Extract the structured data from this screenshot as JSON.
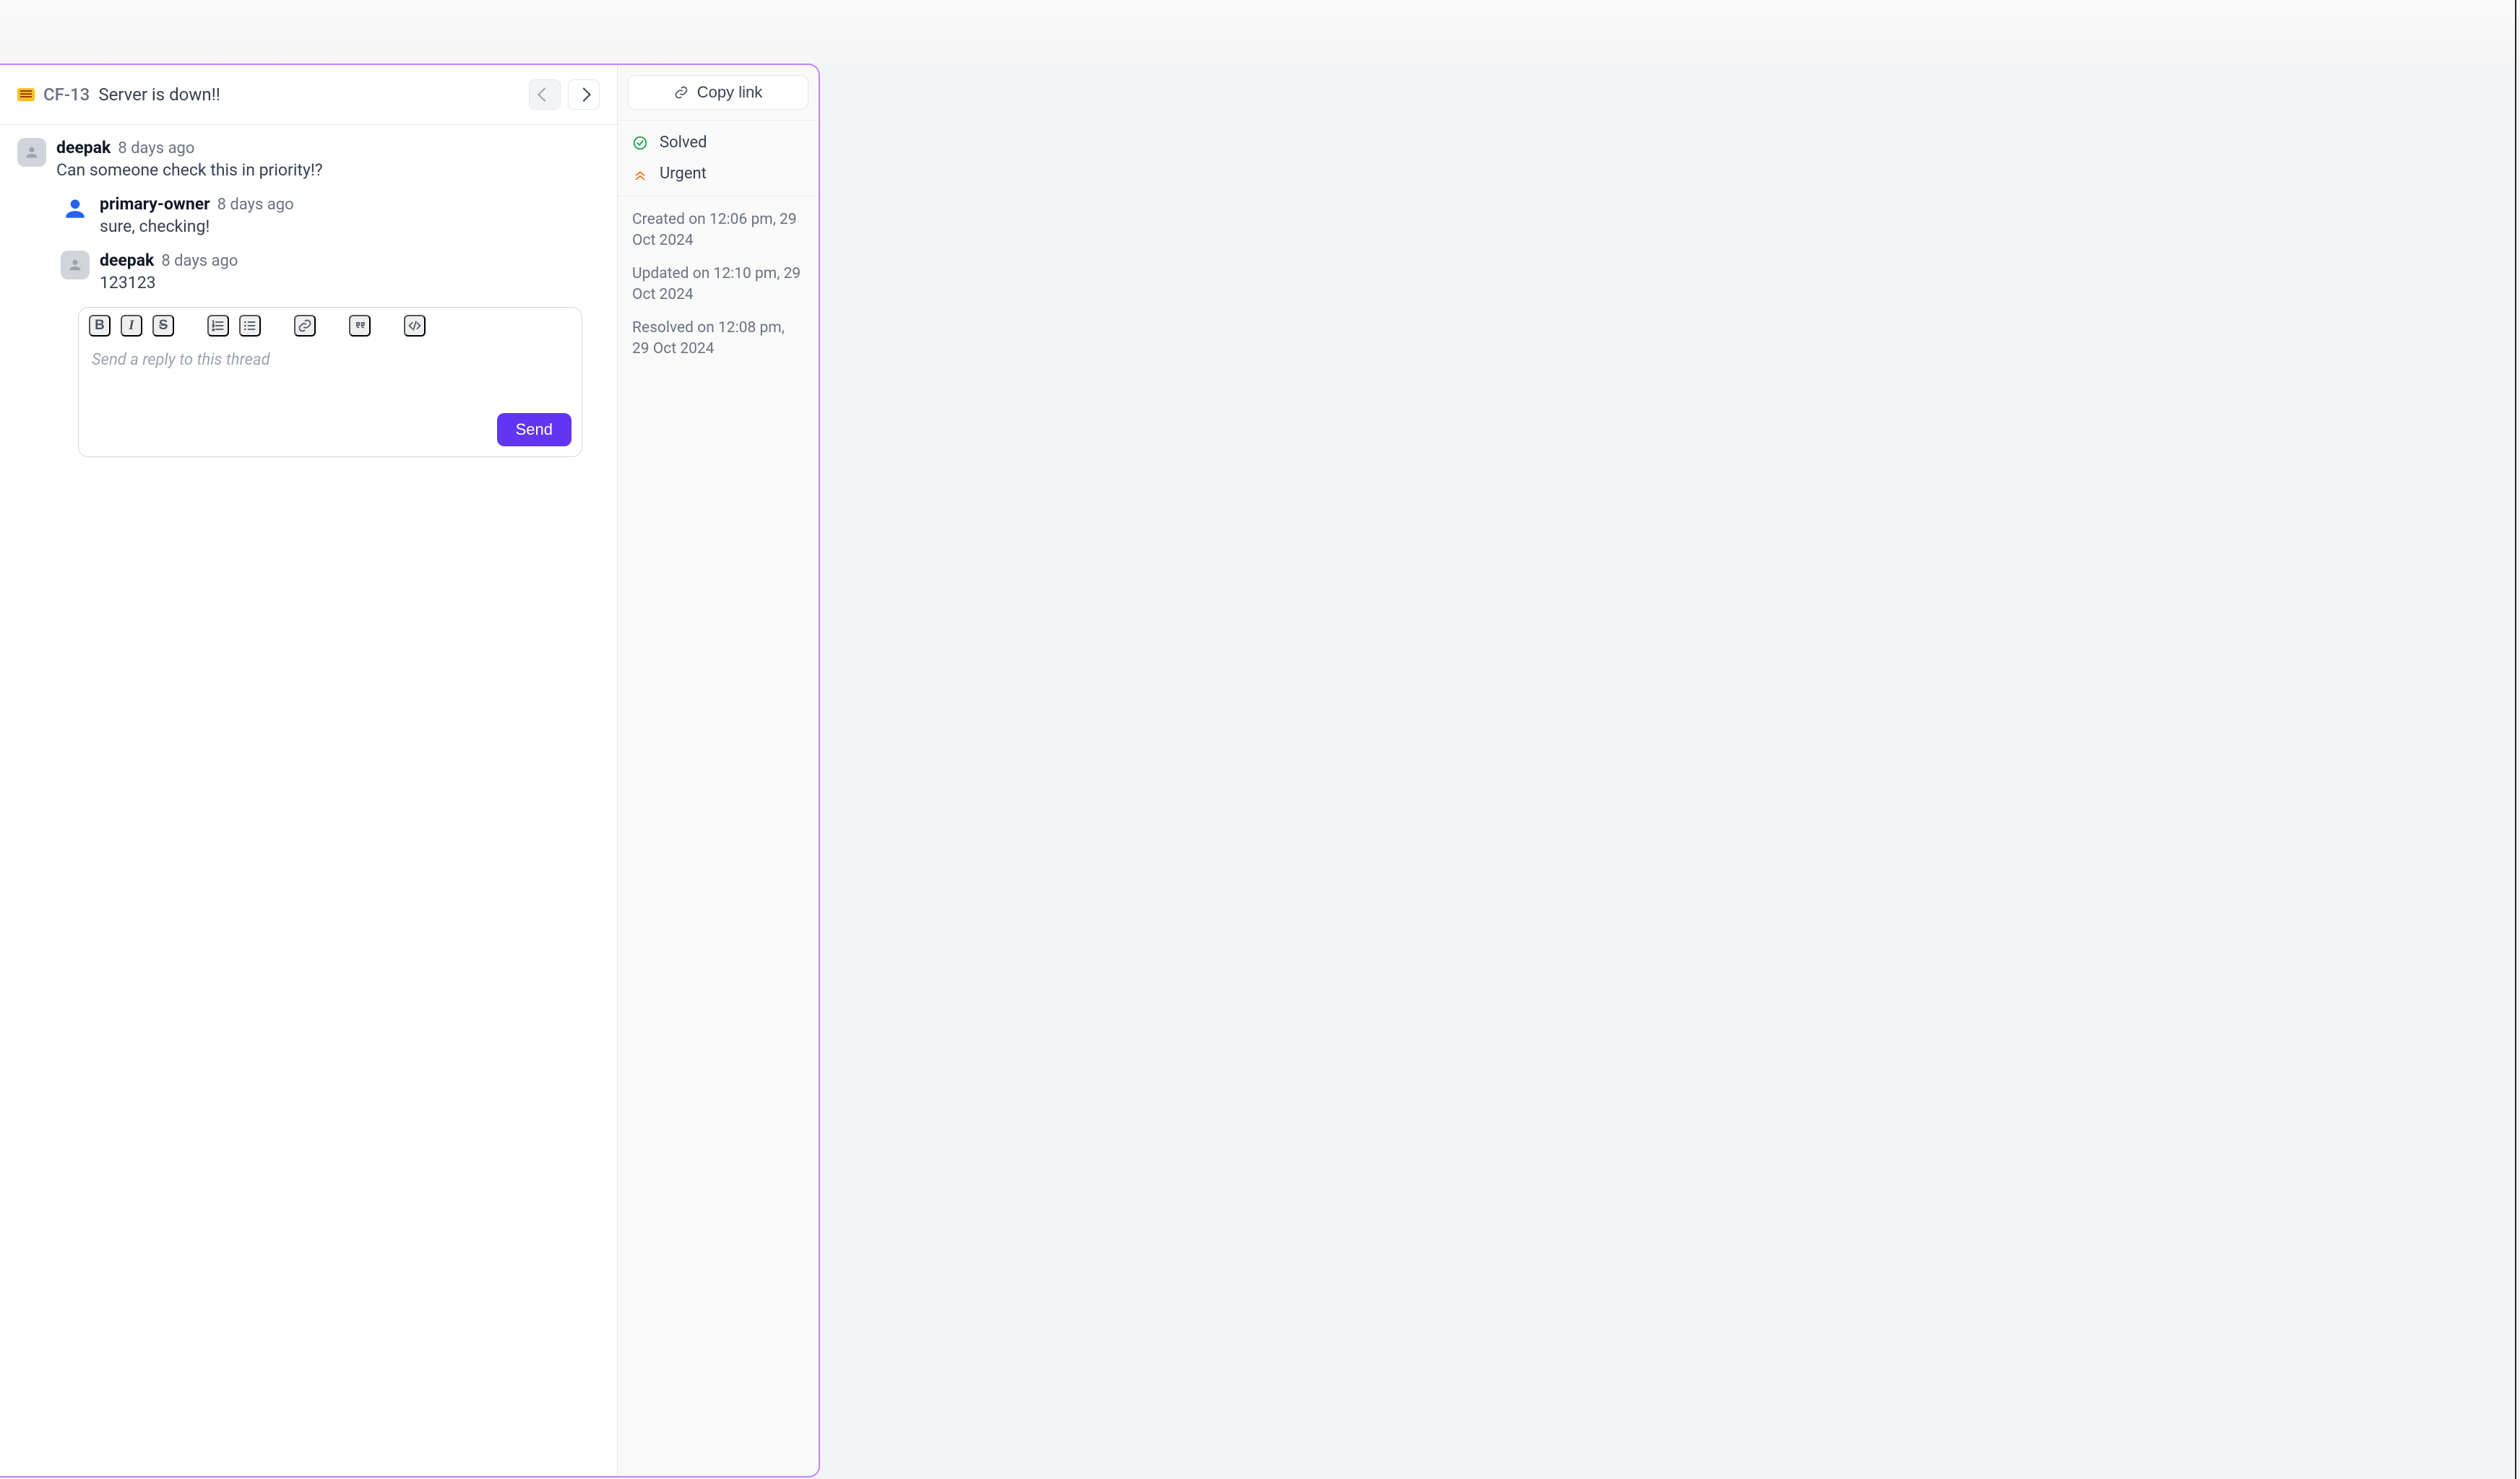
{
  "ticket": {
    "id_label": "CF-13",
    "title": "Server is down!!"
  },
  "thread": {
    "root": {
      "author": "deepak",
      "timestamp": "8 days ago",
      "text": "Can someone check this in priority!?"
    },
    "replies": [
      {
        "author": "primary-owner",
        "timestamp": "8 days ago",
        "text": "sure, checking!"
      },
      {
        "author": "deepak",
        "timestamp": "8 days ago",
        "text": "123123"
      }
    ]
  },
  "composer": {
    "placeholder": "Send a reply to this thread",
    "send_label": "Send",
    "tools": {
      "bold": "B",
      "italic": "I",
      "strike": "S"
    }
  },
  "sidebar": {
    "copy_link_label": "Copy link",
    "status_label": "Solved",
    "priority_label": "Urgent",
    "meta": {
      "created": "Created on 12:06 pm, 29 Oct 2024",
      "updated": "Updated on 12:10 pm, 29 Oct 2024",
      "resolved": "Resolved on 12:08 pm, 29 Oct 2024"
    }
  }
}
